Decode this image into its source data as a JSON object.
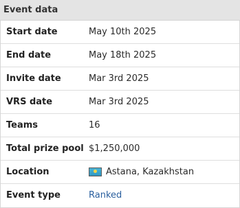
{
  "panel": {
    "title": "Event data"
  },
  "rows": [
    {
      "label": "Start date",
      "value": "May 10th 2025"
    },
    {
      "label": "End date",
      "value": "May 18th 2025"
    },
    {
      "label": "Invite date",
      "value": "Mar 3rd 2025"
    },
    {
      "label": "VRS date",
      "value": "Mar 3rd 2025"
    },
    {
      "label": "Teams",
      "value": "16"
    },
    {
      "label": "Total prize pool",
      "value": "$1,250,000"
    },
    {
      "label": "Location",
      "value": "Astana, Kazakhstan",
      "icon": "kazakhstan-flag-icon"
    },
    {
      "label": "Event type",
      "value": "Ranked"
    }
  ],
  "colors": {
    "header_bg": "#e4e4e4",
    "link": "#2a5f9e"
  }
}
